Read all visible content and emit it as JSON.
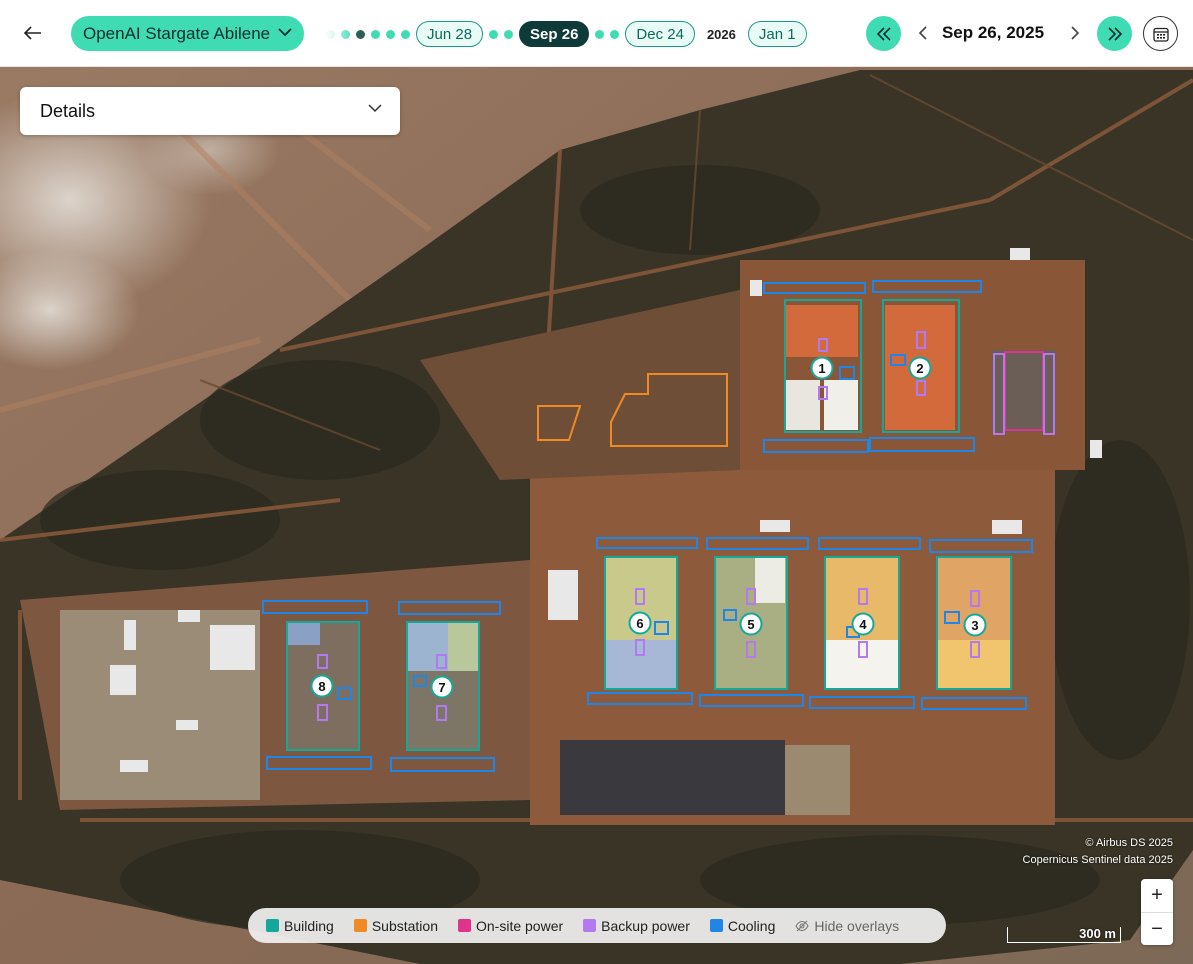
{
  "site": {
    "name": "OpenAI Stargate Abilene"
  },
  "timeline": {
    "labels": {
      "jun28": "Jun 28",
      "sep26": "Sep 26",
      "dec24": "Dec 24",
      "year": "2026",
      "jan": "Jan 1"
    },
    "active": "Sep 26"
  },
  "date": {
    "current": "Sep 26, 2025"
  },
  "details": {
    "label": "Details"
  },
  "buildings": [
    "1",
    "2",
    "3",
    "4",
    "5",
    "6",
    "7",
    "8"
  ],
  "credits": {
    "line1": "© Airbus DS 2025",
    "line2": "Copernicus Sentinel data 2025"
  },
  "legend": {
    "building": "Building",
    "substation": "Substation",
    "onsite_power": "On-site power",
    "backup_power": "Backup power",
    "cooling": "Cooling",
    "hide": "Hide overlays"
  },
  "colors": {
    "accent": "#3fdcb4",
    "building": "#14a89a",
    "substation": "#f08a24",
    "onsite_power": "#e0348a",
    "backup_power": "#b279f0",
    "cooling": "#1f86e8"
  },
  "zoom": {
    "in": "+",
    "out": "−"
  },
  "scale": {
    "label": "300 m"
  }
}
